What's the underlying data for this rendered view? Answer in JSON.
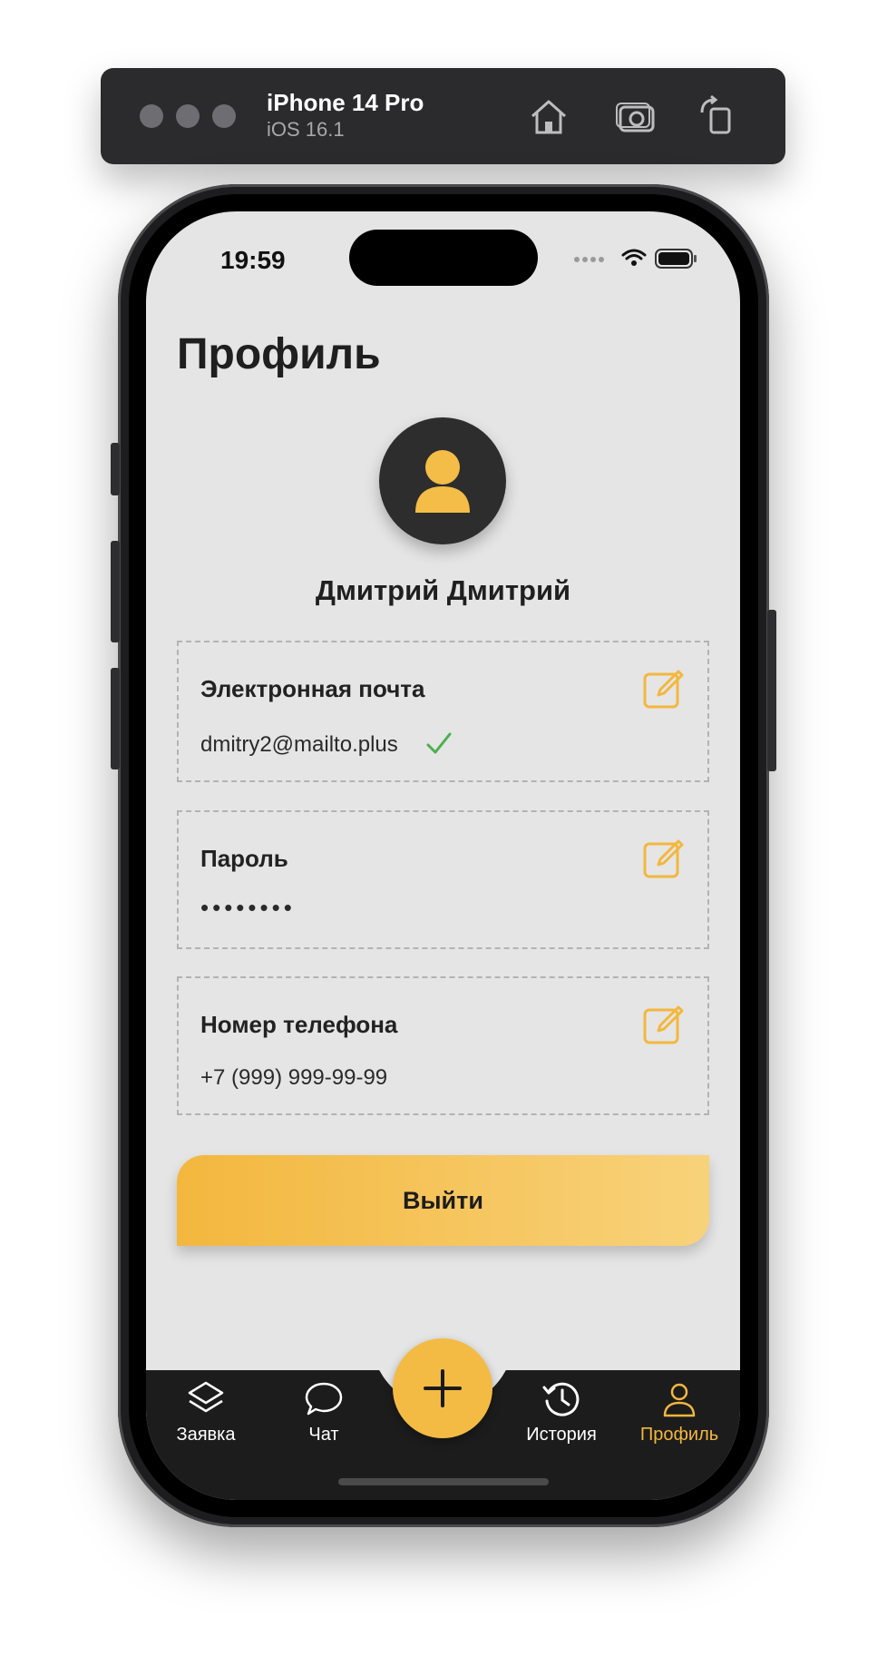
{
  "simulator": {
    "device": "iPhone 14 Pro",
    "os": "iOS 16.1",
    "icons": [
      "home-icon",
      "screenshot-icon",
      "rotate-icon"
    ]
  },
  "status": {
    "time": "19:59"
  },
  "page": {
    "title": "Профиль",
    "user_name": "Дмитрий Дмитрий"
  },
  "fields": [
    {
      "label": "Электронная почта",
      "value": "dmitry2@mailto.plus",
      "verified": true
    },
    {
      "label": "Пароль",
      "value": "••••••••"
    },
    {
      "label": "Номер телефона",
      "value": "+7 (999) 999-99-99"
    }
  ],
  "logout_label": "Выйти",
  "tabbar": {
    "items": [
      {
        "label": "Заявка",
        "icon": "layers-icon"
      },
      {
        "label": "Чат",
        "icon": "chat-icon"
      },
      {
        "label": "История",
        "icon": "history-icon"
      },
      {
        "label": "Профиль",
        "icon": "profile-icon",
        "active": true
      }
    ],
    "fab_icon": "plus-icon"
  },
  "colors": {
    "accent": "#f3b73e",
    "background": "#e5e5e5",
    "tabbar": "#1c1c1c",
    "verified": "#4caf50"
  }
}
